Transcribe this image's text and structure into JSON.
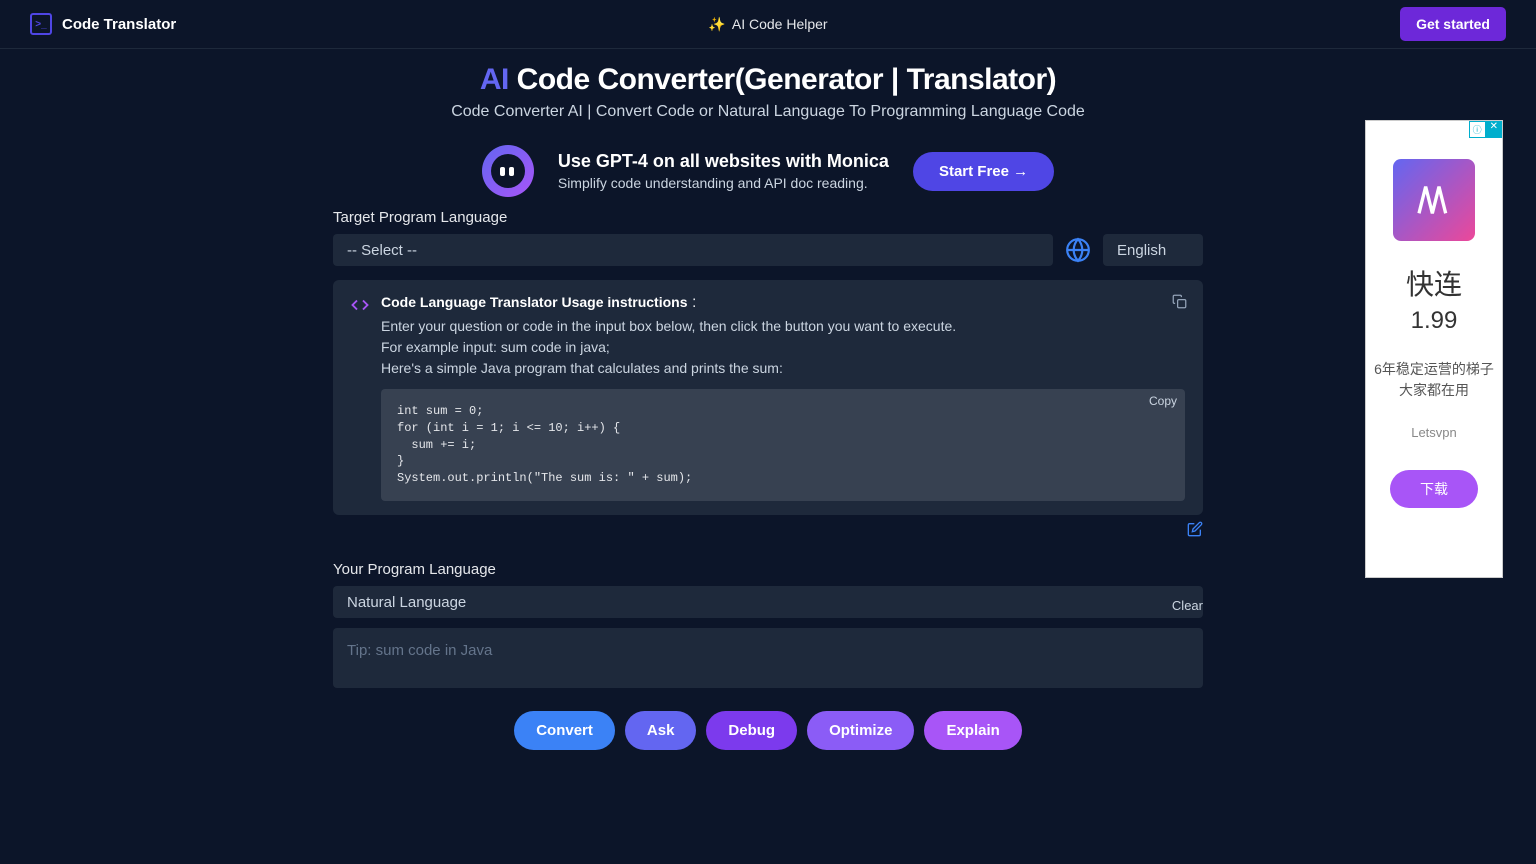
{
  "header": {
    "logo_text": "Code Translator",
    "center_text": "AI Code Helper",
    "sparkle": "✨",
    "get_started": "Get started"
  },
  "hero": {
    "ai": "AI",
    "title_rest": " Code Converter(Generator | Translator)",
    "subtitle": "Code Converter AI | Convert Code or Natural Language To Programming Language Code"
  },
  "promo": {
    "title": "Use GPT-4 on all websites with Monica",
    "subtitle": "Simplify code understanding and API doc reading.",
    "button": "Start Free →"
  },
  "target": {
    "label": "Target Program Language",
    "select_placeholder": "-- Select --",
    "lang_value": "English"
  },
  "instructions": {
    "title": "Code Language Translator Usage instructions",
    "colon": " :",
    "line1": "Enter your question or code in the input box below, then click the button you want to execute.",
    "line2": "For example input: sum code in java;",
    "line3": "Here's a simple Java program that calculates and prints the sum:",
    "code": "int sum = 0;\nfor (int i = 1; i <= 10; i++) {\n  sum += i;\n}\nSystem.out.println(\"The sum is: \" + sum);",
    "copy": "Copy"
  },
  "your": {
    "label": "Your Program Language",
    "select_value": "Natural Language",
    "placeholder": "Tip: sum code in Java",
    "clear": "Clear"
  },
  "actions": {
    "convert": "Convert",
    "ask": "Ask",
    "debug": "Debug",
    "optimize": "Optimize",
    "explain": "Explain"
  },
  "ad": {
    "title": "快连",
    "price": "1.99",
    "desc": "6年稳定运营的梯子 大家都在用",
    "brand": "Letsvpn",
    "button": "下载",
    "close": "✕"
  }
}
